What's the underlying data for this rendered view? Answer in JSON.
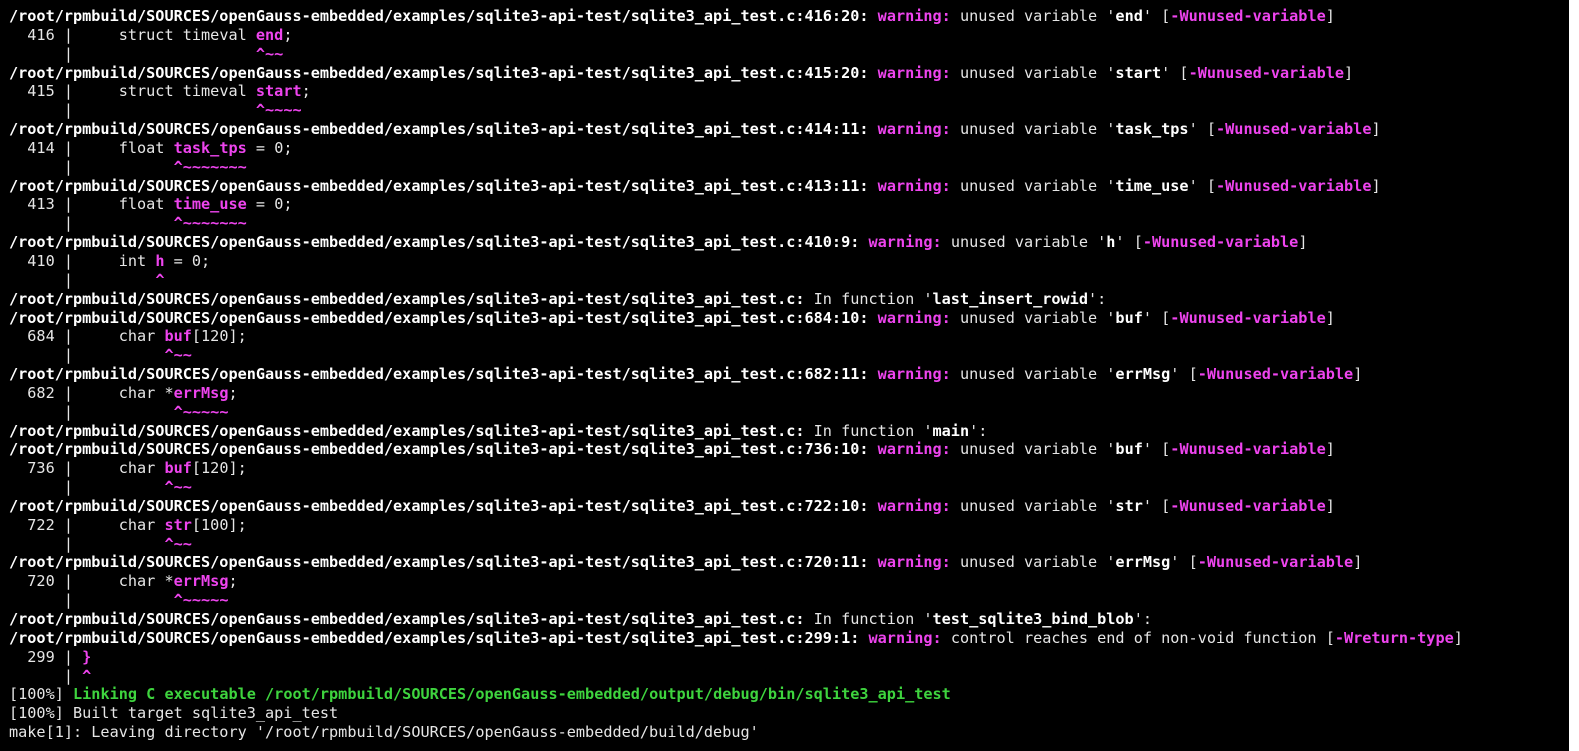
{
  "terminal": {
    "colors": {
      "background": "#000000",
      "text": "#e6e6e6",
      "bold_white": "#ffffff",
      "magenta": "#ee44ee",
      "green": "#3ed43e"
    },
    "path_prefix": "/root/rpmbuild/SOURCES/openGauss-embedded/examples/sqlite3-api-test/sqlite3_api_test.c",
    "lines": [
      {
        "kind": "diag",
        "path": "/root/rpmbuild/SOURCES/openGauss-embedded/examples/sqlite3-api-test/sqlite3_api_test.c:416:20:",
        "label": "warning:",
        "msg_pre": " unused variable '",
        "ident": "end",
        "msg_post": "' [",
        "flag": "-Wunused-variable",
        "tail": "]"
      },
      {
        "kind": "src",
        "num": "  416 |     ",
        "pre": "struct timeval ",
        "hl": "end",
        "post": ";"
      },
      {
        "kind": "caret",
        "gutter": "      |     ",
        "pad": "               ",
        "mark": "^~~"
      },
      {
        "kind": "diag",
        "path": "/root/rpmbuild/SOURCES/openGauss-embedded/examples/sqlite3-api-test/sqlite3_api_test.c:415:20:",
        "label": "warning:",
        "msg_pre": " unused variable '",
        "ident": "start",
        "msg_post": "' [",
        "flag": "-Wunused-variable",
        "tail": "]"
      },
      {
        "kind": "src",
        "num": "  415 |     ",
        "pre": "struct timeval ",
        "hl": "start",
        "post": ";"
      },
      {
        "kind": "caret",
        "gutter": "      |     ",
        "pad": "               ",
        "mark": "^~~~~"
      },
      {
        "kind": "diag",
        "path": "/root/rpmbuild/SOURCES/openGauss-embedded/examples/sqlite3-api-test/sqlite3_api_test.c:414:11:",
        "label": "warning:",
        "msg_pre": " unused variable '",
        "ident": "task_tps",
        "msg_post": "' [",
        "flag": "-Wunused-variable",
        "tail": "]"
      },
      {
        "kind": "src",
        "num": "  414 |     ",
        "pre": "float ",
        "hl": "task_tps",
        "post": " = 0;"
      },
      {
        "kind": "caret",
        "gutter": "      |     ",
        "pad": "      ",
        "mark": "^~~~~~~~"
      },
      {
        "kind": "diag",
        "path": "/root/rpmbuild/SOURCES/openGauss-embedded/examples/sqlite3-api-test/sqlite3_api_test.c:413:11:",
        "label": "warning:",
        "msg_pre": " unused variable '",
        "ident": "time_use",
        "msg_post": "' [",
        "flag": "-Wunused-variable",
        "tail": "]"
      },
      {
        "kind": "src",
        "num": "  413 |     ",
        "pre": "float ",
        "hl": "time_use",
        "post": " = 0;"
      },
      {
        "kind": "caret",
        "gutter": "      |     ",
        "pad": "      ",
        "mark": "^~~~~~~~"
      },
      {
        "kind": "diag",
        "path": "/root/rpmbuild/SOURCES/openGauss-embedded/examples/sqlite3-api-test/sqlite3_api_test.c:410:9:",
        "label": "warning:",
        "msg_pre": " unused variable '",
        "ident": "h",
        "msg_post": "' [",
        "flag": "-Wunused-variable",
        "tail": "]"
      },
      {
        "kind": "src",
        "num": "  410 |     ",
        "pre": "int ",
        "hl": "h",
        "post": " = 0;"
      },
      {
        "kind": "caret",
        "gutter": "      |     ",
        "pad": "    ",
        "mark": "^"
      },
      {
        "kind": "func",
        "path": "/root/rpmbuild/SOURCES/openGauss-embedded/examples/sqlite3-api-test/sqlite3_api_test.c:",
        "text_pre": " In function '",
        "ident": "last_insert_rowid",
        "text_post": "':"
      },
      {
        "kind": "diag",
        "path": "/root/rpmbuild/SOURCES/openGauss-embedded/examples/sqlite3-api-test/sqlite3_api_test.c:684:10:",
        "label": "warning:",
        "msg_pre": " unused variable '",
        "ident": "buf",
        "msg_post": "' [",
        "flag": "-Wunused-variable",
        "tail": "]"
      },
      {
        "kind": "src",
        "num": "  684 |     ",
        "pre": "char ",
        "hl": "buf",
        "post": "[120];"
      },
      {
        "kind": "caret",
        "gutter": "      |     ",
        "pad": "     ",
        "mark": "^~~"
      },
      {
        "kind": "diag",
        "path": "/root/rpmbuild/SOURCES/openGauss-embedded/examples/sqlite3-api-test/sqlite3_api_test.c:682:11:",
        "label": "warning:",
        "msg_pre": " unused variable '",
        "ident": "errMsg",
        "msg_post": "' [",
        "flag": "-Wunused-variable",
        "tail": "]"
      },
      {
        "kind": "src",
        "num": "  682 |     ",
        "pre": "char *",
        "hl": "errMsg",
        "post": ";"
      },
      {
        "kind": "caret",
        "gutter": "      |     ",
        "pad": "      ",
        "mark": "^~~~~~"
      },
      {
        "kind": "func",
        "path": "/root/rpmbuild/SOURCES/openGauss-embedded/examples/sqlite3-api-test/sqlite3_api_test.c:",
        "text_pre": " In function '",
        "ident": "main",
        "text_post": "':"
      },
      {
        "kind": "diag",
        "path": "/root/rpmbuild/SOURCES/openGauss-embedded/examples/sqlite3-api-test/sqlite3_api_test.c:736:10:",
        "label": "warning:",
        "msg_pre": " unused variable '",
        "ident": "buf",
        "msg_post": "' [",
        "flag": "-Wunused-variable",
        "tail": "]"
      },
      {
        "kind": "src",
        "num": "  736 |     ",
        "pre": "char ",
        "hl": "buf",
        "post": "[120];"
      },
      {
        "kind": "caret",
        "gutter": "      |     ",
        "pad": "     ",
        "mark": "^~~"
      },
      {
        "kind": "diag",
        "path": "/root/rpmbuild/SOURCES/openGauss-embedded/examples/sqlite3-api-test/sqlite3_api_test.c:722:10:",
        "label": "warning:",
        "msg_pre": " unused variable '",
        "ident": "str",
        "msg_post": "' [",
        "flag": "-Wunused-variable",
        "tail": "]"
      },
      {
        "kind": "src",
        "num": "  722 |     ",
        "pre": "char ",
        "hl": "str",
        "post": "[100];"
      },
      {
        "kind": "caret",
        "gutter": "      |     ",
        "pad": "     ",
        "mark": "^~~"
      },
      {
        "kind": "diag",
        "path": "/root/rpmbuild/SOURCES/openGauss-embedded/examples/sqlite3-api-test/sqlite3_api_test.c:720:11:",
        "label": "warning:",
        "msg_pre": " unused variable '",
        "ident": "errMsg",
        "msg_post": "' [",
        "flag": "-Wunused-variable",
        "tail": "]"
      },
      {
        "kind": "src",
        "num": "  720 |     ",
        "pre": "char *",
        "hl": "errMsg",
        "post": ";"
      },
      {
        "kind": "caret",
        "gutter": "      |     ",
        "pad": "      ",
        "mark": "^~~~~~"
      },
      {
        "kind": "func",
        "path": "/root/rpmbuild/SOURCES/openGauss-embedded/examples/sqlite3-api-test/sqlite3_api_test.c:",
        "text_pre": " In function '",
        "ident": "test_sqlite3_bind_blob",
        "text_post": "':"
      },
      {
        "kind": "diag2",
        "path": "/root/rpmbuild/SOURCES/openGauss-embedded/examples/sqlite3-api-test/sqlite3_api_test.c:299:1:",
        "label": "warning:",
        "msg": " control reaches end of non-void function [",
        "flag": "-Wreturn-type",
        "tail": "]"
      },
      {
        "kind": "src",
        "num": "  299 | ",
        "pre": "",
        "hl": "}",
        "post": ""
      },
      {
        "kind": "caret",
        "gutter": "      | ",
        "pad": "",
        "mark": "^"
      },
      {
        "kind": "link",
        "prefix": "[100%] ",
        "text": "Linking C executable /root/rpmbuild/SOURCES/openGauss-embedded/output/debug/bin/sqlite3_api_test"
      },
      {
        "kind": "plain",
        "text": "[100%] Built target sqlite3_api_test"
      },
      {
        "kind": "plain",
        "text": "make[1]: Leaving directory '/root/rpmbuild/SOURCES/openGauss-embedded/build/debug'"
      }
    ]
  }
}
